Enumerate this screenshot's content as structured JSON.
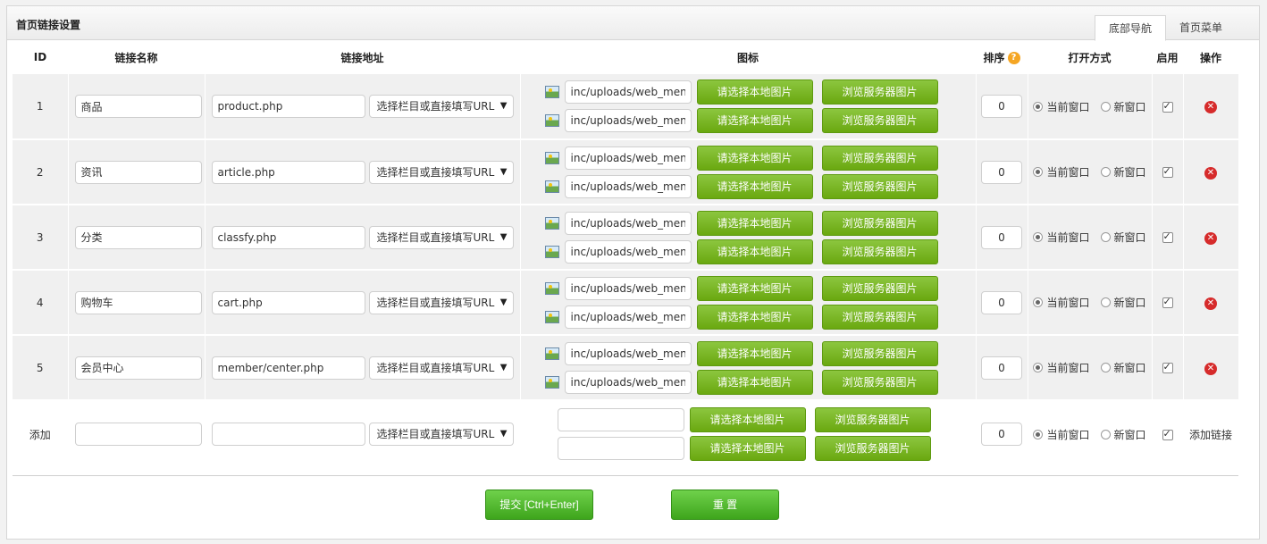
{
  "panel": {
    "title": "首页链接设置"
  },
  "tabs": [
    {
      "label": "底部导航",
      "active": true
    },
    {
      "label": "首页菜单",
      "active": false
    }
  ],
  "columns": {
    "id": "ID",
    "name": "链接名称",
    "address": "链接地址",
    "icon": "图标",
    "sort": "排序",
    "open_mode": "打开方式",
    "enabled": "启用",
    "action": "操作"
  },
  "common": {
    "select_placeholder": "选择栏目或直接填写URL",
    "local_image_btn": "请选择本地图片",
    "server_image_btn": "浏览服务器图片",
    "current_window": "当前窗口",
    "new_window": "新窗口"
  },
  "rows": [
    {
      "id": "1",
      "name": "商品",
      "url": "product.php",
      "icon1": "inc/uploads/web_menu",
      "icon2": "inc/uploads/web_menu",
      "sort": "0"
    },
    {
      "id": "2",
      "name": "资讯",
      "url": "article.php",
      "icon1": "inc/uploads/web_menu",
      "icon2": "inc/uploads/web_menu",
      "sort": "0"
    },
    {
      "id": "3",
      "name": "分类",
      "url": "classfy.php",
      "icon1": "inc/uploads/web_menu",
      "icon2": "inc/uploads/web_menu",
      "sort": "0"
    },
    {
      "id": "4",
      "name": "购物车",
      "url": "cart.php",
      "icon1": "inc/uploads/web_menu",
      "icon2": "inc/uploads/web_menu",
      "sort": "0"
    },
    {
      "id": "5",
      "name": "会员中心",
      "url": "member/center.php",
      "icon1": "inc/uploads/web_menu",
      "icon2": "inc/uploads/web_menu",
      "sort": "0"
    }
  ],
  "add_row": {
    "id_label": "添加",
    "sort": "0",
    "action_label": "添加链接"
  },
  "buttons": {
    "submit": "提交 [Ctrl+Enter]",
    "reset": "重 置"
  },
  "colors": {
    "green_button": "#7ab317",
    "delete_red": "#d62b2b",
    "help_orange": "#f5a623"
  }
}
